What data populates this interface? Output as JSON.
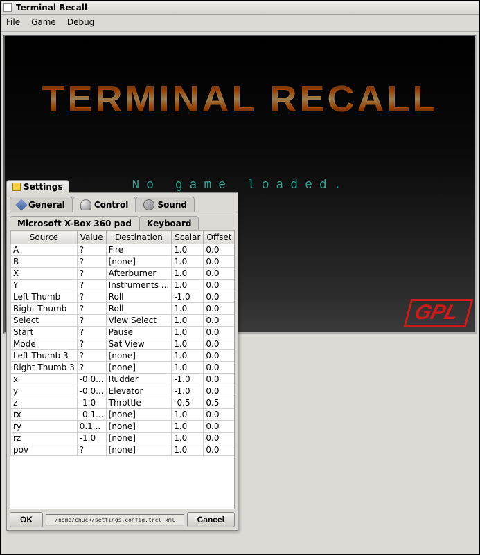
{
  "window": {
    "title": "Terminal Recall"
  },
  "menubar": {
    "file": "File",
    "game": "Game",
    "debug": "Debug"
  },
  "splash": {
    "title": "TERMINAL RECALL",
    "status": "No game loaded.",
    "corner_logo": "GPL"
  },
  "settings": {
    "dialog_title": "Settings",
    "tabs": {
      "general": "General",
      "control": "Control",
      "sound": "Sound"
    },
    "controller_tabs": {
      "xbox": "Microsoft X-Box 360 pad",
      "keyboard": "Keyboard"
    },
    "columns": {
      "source": "Source",
      "value": "Value",
      "destination": "Destination",
      "scalar": "Scalar",
      "offset": "Offset"
    },
    "rows": [
      {
        "source": "A",
        "value": "?",
        "destination": "Fire",
        "scalar": "1.0",
        "offset": "0.0"
      },
      {
        "source": "B",
        "value": "?",
        "destination": "[none]",
        "scalar": "1.0",
        "offset": "0.0"
      },
      {
        "source": "X",
        "value": "?",
        "destination": "Afterburner",
        "scalar": "1.0",
        "offset": "0.0"
      },
      {
        "source": "Y",
        "value": "?",
        "destination": "Instruments ...",
        "scalar": "1.0",
        "offset": "0.0"
      },
      {
        "source": "Left Thumb",
        "value": "?",
        "destination": "Roll",
        "scalar": "-1.0",
        "offset": "0.0"
      },
      {
        "source": "Right Thumb",
        "value": "?",
        "destination": "Roll",
        "scalar": "1.0",
        "offset": "0.0"
      },
      {
        "source": "Select",
        "value": "?",
        "destination": "View Select",
        "scalar": "1.0",
        "offset": "0.0"
      },
      {
        "source": "Start",
        "value": "?",
        "destination": "Pause",
        "scalar": "1.0",
        "offset": "0.0"
      },
      {
        "source": "Mode",
        "value": "?",
        "destination": "Sat View",
        "scalar": "1.0",
        "offset": "0.0"
      },
      {
        "source": "Left Thumb 3",
        "value": "?",
        "destination": "[none]",
        "scalar": "1.0",
        "offset": "0.0"
      },
      {
        "source": "Right Thumb 3",
        "value": "?",
        "destination": "[none]",
        "scalar": "1.0",
        "offset": "0.0"
      },
      {
        "source": "x",
        "value": "-0.0...",
        "destination": "Rudder",
        "scalar": "-1.0",
        "offset": "0.0"
      },
      {
        "source": "y",
        "value": "-0.0...",
        "destination": "Elevator",
        "scalar": "-1.0",
        "offset": "0.0"
      },
      {
        "source": "z",
        "value": "-1.0",
        "destination": "Throttle",
        "scalar": "-0.5",
        "offset": "0.5"
      },
      {
        "source": "rx",
        "value": "-0.1...",
        "destination": "[none]",
        "scalar": "1.0",
        "offset": "0.0"
      },
      {
        "source": "ry",
        "value": "0.1...",
        "destination": "[none]",
        "scalar": "1.0",
        "offset": "0.0"
      },
      {
        "source": "rz",
        "value": "-1.0",
        "destination": "[none]",
        "scalar": "1.0",
        "offset": "0.0"
      },
      {
        "source": "pov",
        "value": "?",
        "destination": "[none]",
        "scalar": "1.0",
        "offset": "0.0"
      }
    ],
    "footer_path": "/home/chuck/settings.config.trcl.xml",
    "ok": "OK",
    "cancel": "Cancel"
  }
}
